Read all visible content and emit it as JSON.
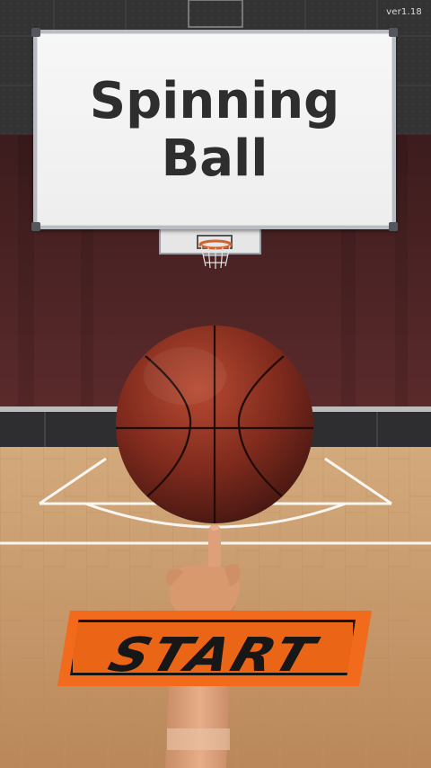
{
  "version_label": "ver1.18",
  "title": {
    "line1": "Spinning",
    "line2": "Ball"
  },
  "start_button": {
    "label": "START"
  },
  "colors": {
    "accent_orange": "#f26a1b",
    "title_text": "#2e2e2e",
    "ball": "#8b2d1c",
    "wall": "#4a2122",
    "floor": "#c89b6b"
  }
}
